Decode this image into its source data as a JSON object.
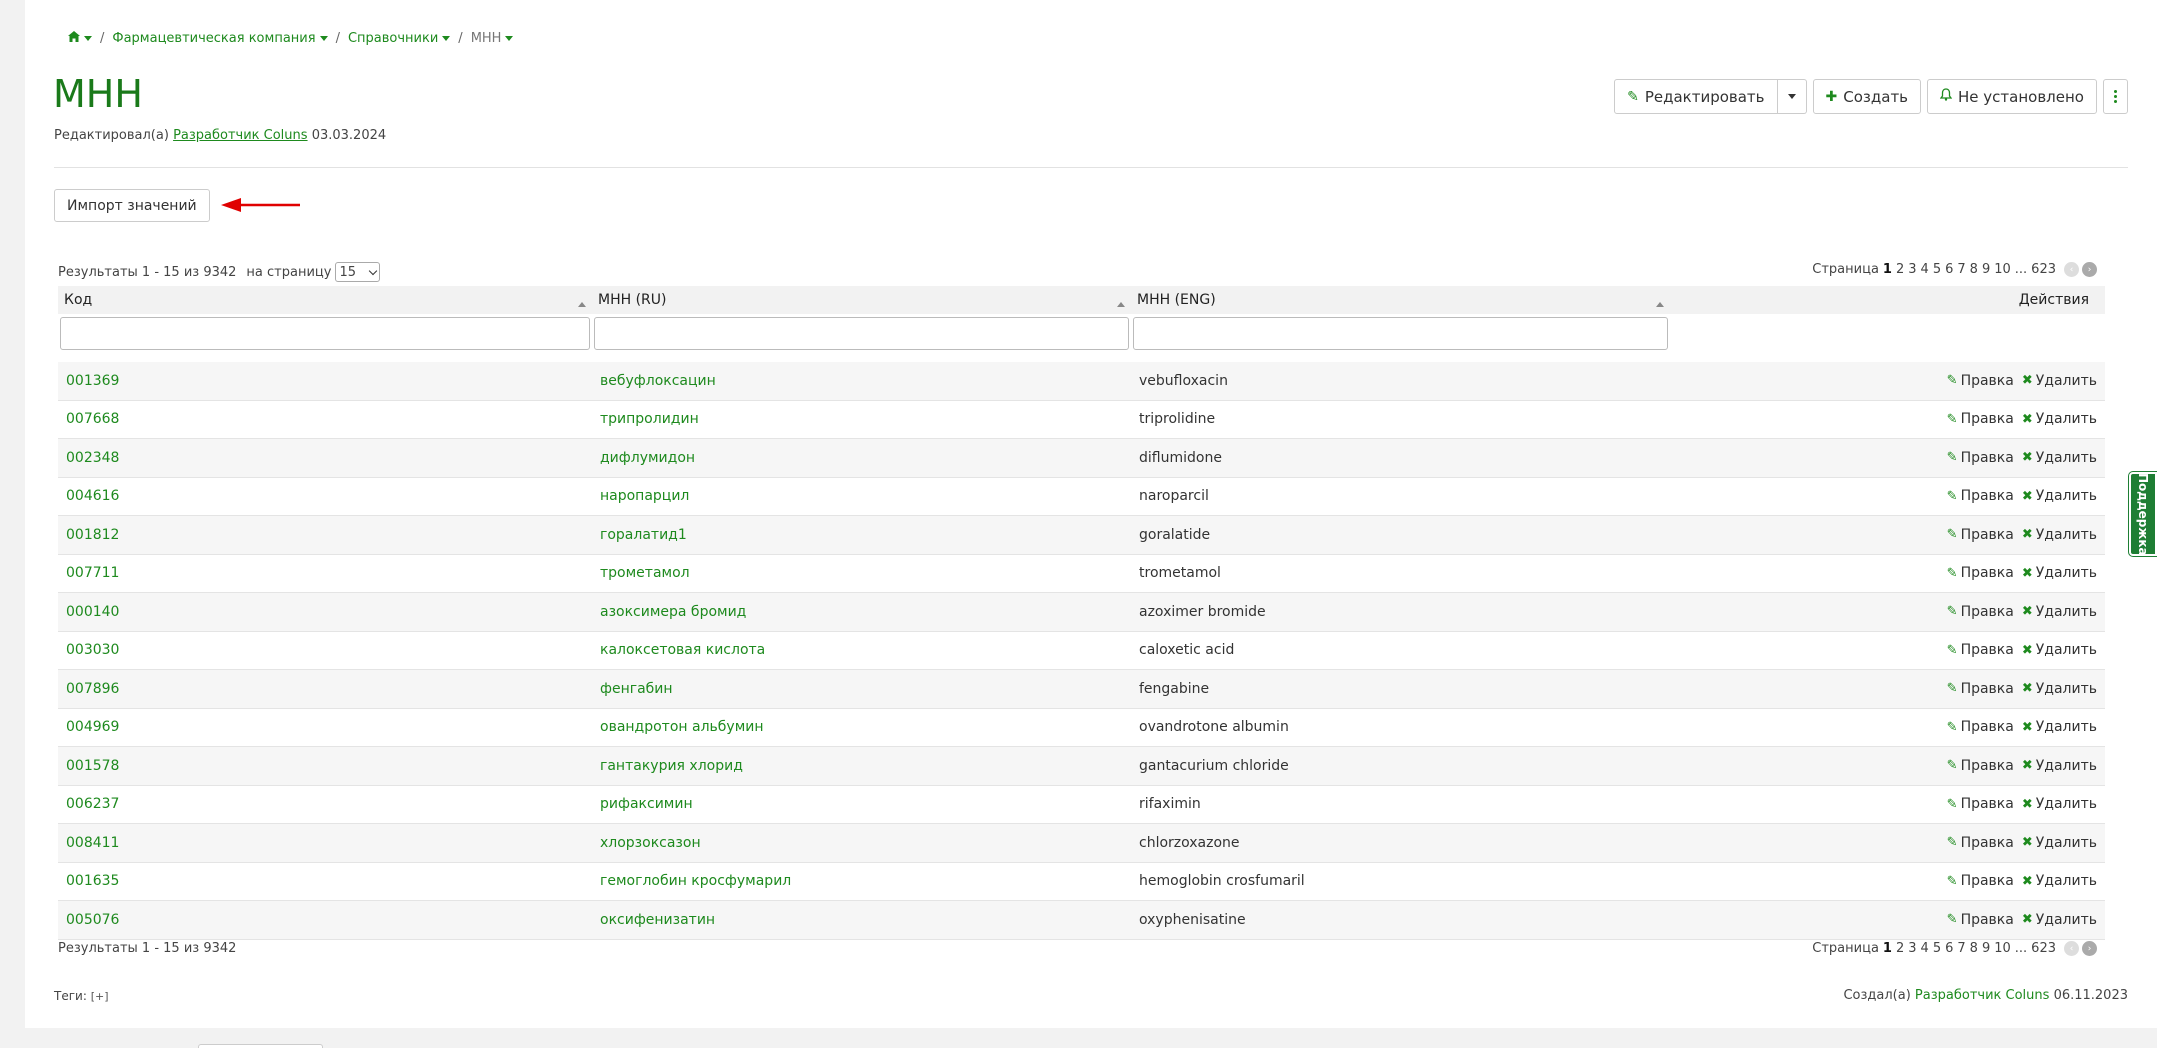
{
  "breadcrumb": {
    "home_icon": "home-icon",
    "items": [
      "Фармацевтическая компания",
      "Справочники"
    ],
    "current": "МНН"
  },
  "page": {
    "title": "МНН",
    "edited_prefix": "Редактировал(а)",
    "edited_by": "Разработчик Coluns",
    "edited_date": "03.03.2024"
  },
  "top_actions": {
    "edit_label": "Редактировать",
    "create_label": "Создать",
    "notify_label": "Не установлено"
  },
  "import_label": "Импорт значений",
  "results": {
    "summary": "Результаты 1 - 15 из 9342",
    "per_page_label": "на страницу",
    "per_page_value": "15",
    "page_label": "Страница",
    "pages": [
      "1",
      "2",
      "3",
      "4",
      "5",
      "6",
      "7",
      "8",
      "9",
      "10"
    ],
    "ellipsis": "...",
    "last_page": "623"
  },
  "table": {
    "columns": [
      "Код",
      "МНН (RU)",
      "МНН (ENG)",
      "Действия"
    ],
    "edit_label": "Правка",
    "delete_label": "Удалить",
    "rows": [
      {
        "code": "001369",
        "ru": "вебуфлоксацин",
        "eng": "vebufloxacin"
      },
      {
        "code": "007668",
        "ru": "трипролидин",
        "eng": "triprolidine"
      },
      {
        "code": "002348",
        "ru": "дифлумидон",
        "eng": "diflumidone"
      },
      {
        "code": "004616",
        "ru": "наропарцил",
        "eng": "naroparcil"
      },
      {
        "code": "001812",
        "ru": "горалатид1",
        "eng": "goralatide"
      },
      {
        "code": "007711",
        "ru": "трометамол",
        "eng": "trometamol"
      },
      {
        "code": "000140",
        "ru": "азоксимера бромид",
        "eng": "azoximer bromide"
      },
      {
        "code": "003030",
        "ru": "калоксетовая кислота",
        "eng": "caloxetic acid"
      },
      {
        "code": "007896",
        "ru": "фенгабин",
        "eng": "fengabine"
      },
      {
        "code": "004969",
        "ru": "овандротон альбумин",
        "eng": "ovandrotone albumin"
      },
      {
        "code": "001578",
        "ru": "гантакурия хлорид",
        "eng": "gantacurium chloride"
      },
      {
        "code": "006237",
        "ru": "рифаксимин",
        "eng": "rifaximin"
      },
      {
        "code": "008411",
        "ru": "хлорзоксазон",
        "eng": "chlorzoxazone"
      },
      {
        "code": "001635",
        "ru": "гемоглобин кросфумарил",
        "eng": "hemoglobin crosfumaril"
      },
      {
        "code": "005076",
        "ru": "оксифенизатин",
        "eng": "oxyphenisatine"
      }
    ]
  },
  "footer": {
    "tags_label": "Теги:",
    "tags_add": "[+]",
    "created_prefix": "Создал(а)",
    "created_by": "Разработчик Coluns",
    "created_date": "06.11.2023"
  },
  "support_label": "Поддержка",
  "colors": {
    "accent": "#1e8a1e",
    "arrow": "#e00000"
  }
}
